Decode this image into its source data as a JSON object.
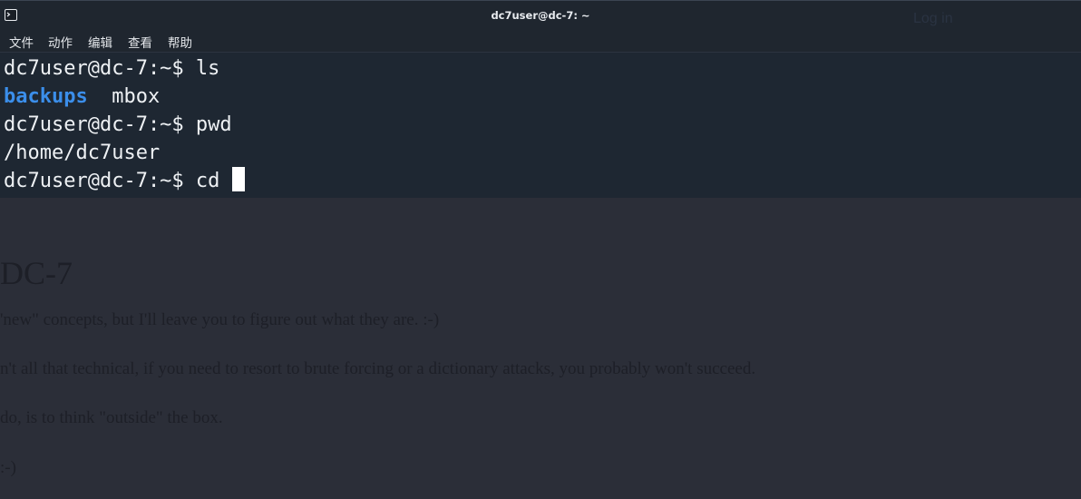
{
  "background_page": {
    "login_link": "Log in",
    "heading": "DC-7",
    "lines": [
      "'new\" concepts, but I'll leave you to figure out what they are.  :-)",
      "n't all that technical, if you need to resort to brute forcing or a dictionary attacks, you probably won't succeed.",
      "do, is to think \"outside\" the box.",
      ":-)"
    ]
  },
  "terminal": {
    "window_title": "dc7user@dc-7: ~",
    "menu": [
      "文件",
      "动作",
      "编辑",
      "查看",
      "帮助"
    ],
    "lines": [
      {
        "prompt": "dc7user@dc-7:~$ ",
        "command": "ls"
      },
      {
        "output_dir": "backups",
        "output_sep": "  ",
        "output_file": "mbox"
      },
      {
        "prompt": "dc7user@dc-7:~$ ",
        "command": "pwd"
      },
      {
        "output": "/home/dc7user"
      },
      {
        "prompt": "dc7user@dc-7:~$ ",
        "command": "cd "
      }
    ]
  },
  "colors": {
    "terminal_bg": "#1e2732",
    "directory": "#3b8eea",
    "text": "#eef1f4"
  }
}
